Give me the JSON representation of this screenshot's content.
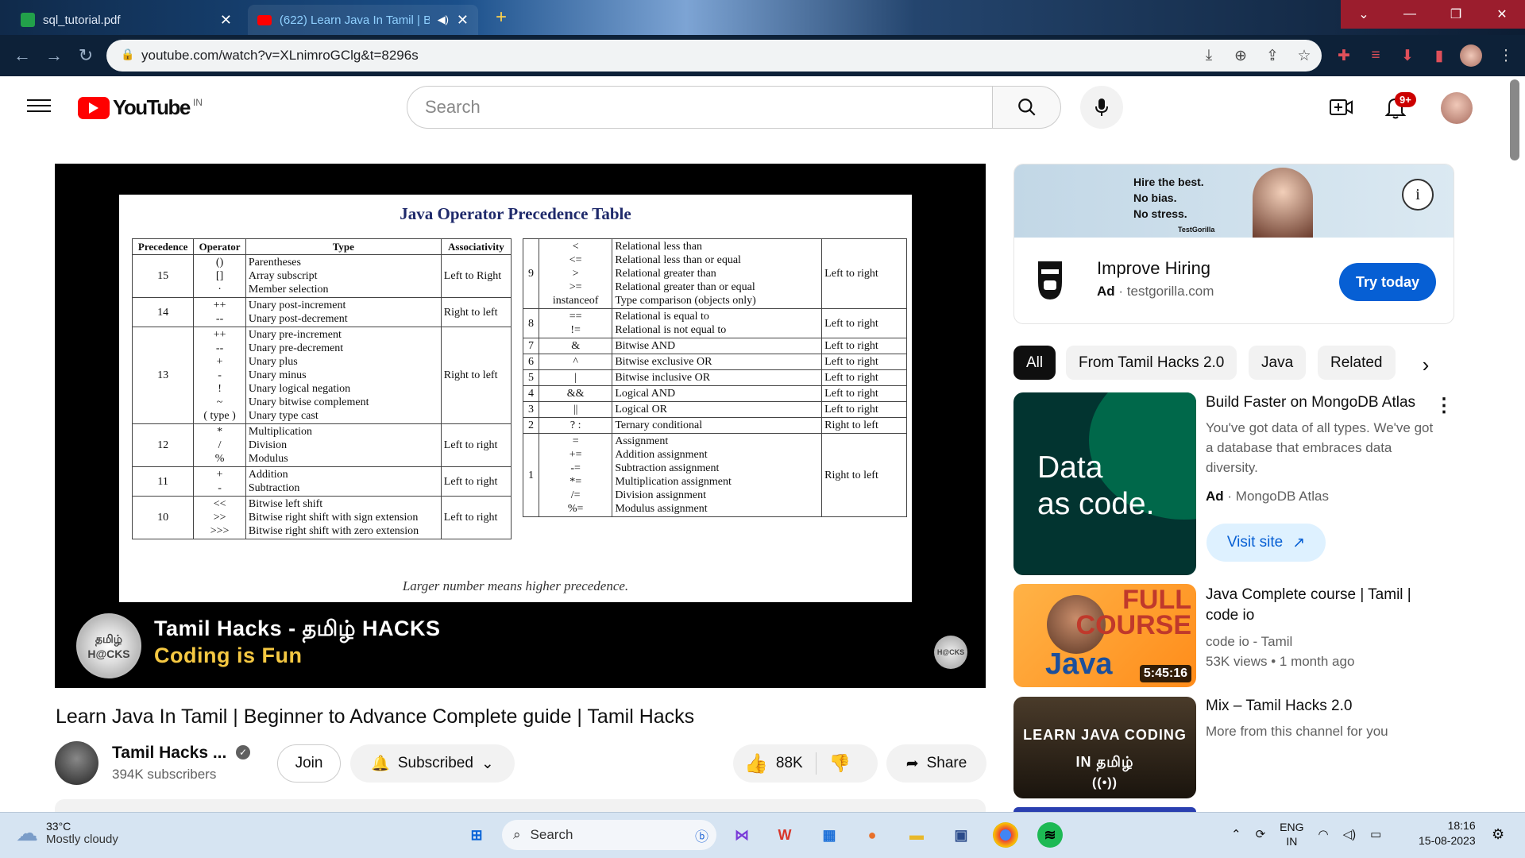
{
  "browser": {
    "tabs": [
      {
        "label": "sql_tutorial.pdf"
      },
      {
        "label": "(622) Learn Java In Tamil | Be"
      }
    ],
    "new_tab_glyph": "+",
    "url": "youtube.com/watch?v=XLnimroGClg&t=8296s"
  },
  "youtube": {
    "logo_text": "YouTube",
    "country": "IN",
    "search_placeholder": "Search",
    "notification_badge": "9+"
  },
  "video": {
    "slide_title": "Java Operator Precedence Table",
    "left_table": {
      "headers": [
        "Precedence",
        "Operator",
        "Type",
        "Associativity"
      ],
      "rows": [
        {
          "prec": "15",
          "ops": "()\n[]\n·",
          "types": "Parentheses\nArray subscript\nMember selection",
          "assoc": "Left to Right"
        },
        {
          "prec": "14",
          "ops": "++\n--",
          "types": "Unary post-increment\nUnary post-decrement",
          "assoc": "Right to left"
        },
        {
          "prec": "13",
          "ops": "++\n--\n+\n-\n!\n~\n( type )",
          "types": "Unary pre-increment\nUnary pre-decrement\nUnary plus\nUnary minus\nUnary logical negation\nUnary bitwise complement\nUnary type cast",
          "assoc": "Right to left"
        },
        {
          "prec": "12",
          "ops": "*\n/\n%",
          "types": "Multiplication\nDivision\nModulus",
          "assoc": "Left to right"
        },
        {
          "prec": "11",
          "ops": "+\n-",
          "types": "Addition\nSubtraction",
          "assoc": "Left to right"
        },
        {
          "prec": "10",
          "ops": "<<\n>>\n>>>",
          "types": "Bitwise left shift\nBitwise right shift with sign extension\nBitwise right shift with zero extension",
          "assoc": "Left to right"
        }
      ]
    },
    "right_table": {
      "rows": [
        {
          "prec": "9",
          "ops": "<\n<=\n>\n>=\ninstanceof",
          "types": "Relational less than\nRelational less than or equal\nRelational greater than\nRelational greater than or equal\nType comparison (objects only)",
          "assoc": "Left to right"
        },
        {
          "prec": "8",
          "ops": "==\n!=",
          "types": "Relational is equal to\nRelational is not equal to",
          "assoc": "Left to right"
        },
        {
          "prec": "7",
          "ops": "&",
          "types": "Bitwise AND",
          "assoc": "Left to right"
        },
        {
          "prec": "6",
          "ops": "^",
          "types": "Bitwise exclusive OR",
          "assoc": "Left to right"
        },
        {
          "prec": "5",
          "ops": "|",
          "types": "Bitwise inclusive OR",
          "assoc": "Left to right"
        },
        {
          "prec": "4",
          "ops": "&&",
          "types": "Logical AND",
          "assoc": "Left to right"
        },
        {
          "prec": "3",
          "ops": "||",
          "types": "Logical OR",
          "assoc": "Left to right"
        },
        {
          "prec": "2",
          "ops": "? :",
          "types": "Ternary conditional",
          "assoc": "Right to left"
        },
        {
          "prec": "1",
          "ops": "=\n+=\n-=\n*=\n/=\n%=",
          "types": "Assignment\nAddition assignment\nSubtraction assignment\nMultiplication assignment\nDivision assignment\nModulus assignment",
          "assoc": "Right to left"
        }
      ]
    },
    "slide_footer": "Larger number means higher precedence.",
    "overlay_line1": "Tamil Hacks - தமிழ் HACKS",
    "overlay_line2": "Coding is Fun",
    "channel_logo_text": "தமிழ் H@CKS",
    "title": "Learn Java In Tamil | Beginner to Advance Complete guide | Tamil Hacks",
    "channel_name": "Tamil Hacks ...",
    "subscribers": "394K subscribers",
    "join_label": "Join",
    "subscribed_label": "Subscribed",
    "likes": "88K",
    "share_label": "Share"
  },
  "sidebar": {
    "ad": {
      "banner_lines": [
        "Hire the best.",
        "No bias.",
        "No stress."
      ],
      "banner_brand": "TestGorilla",
      "headline": "Improve Hiring",
      "ad_label": "Ad",
      "domain": "testgorilla.com",
      "cta": "Try today"
    },
    "chips": [
      "All",
      "From Tamil Hacks 2.0",
      "Java",
      "Related"
    ],
    "items": [
      {
        "thumb_text": "Data\nas code.",
        "title": "Build Faster on MongoDB Atlas",
        "desc": "You've got data of all types. We've got a database that embraces data diversity.",
        "ad_label": "Ad",
        "advertiser": "MongoDB Atlas",
        "cta": "Visit site"
      },
      {
        "thumb_full": "FULL\nCOURSE",
        "thumb_java": "Java",
        "duration": "5:45:16",
        "title": "Java Complete course | Tamil | code io",
        "channel": "code io - Tamil",
        "views": "53K views",
        "age": "1 month ago"
      },
      {
        "thumb_line1": "LEARN  JAVA CODING",
        "thumb_line2": "IN தமிழ்",
        "title": "Mix – Tamil Hacks 2.0",
        "subtitle": "More from this channel for you"
      }
    ]
  },
  "taskbar": {
    "temperature": "33°C",
    "weather": "Mostly cloudy",
    "search_label": "Search",
    "lang_line1": "ENG",
    "lang_line2": "IN",
    "time": "18:16",
    "date": "15-08-2023"
  },
  "colors": {
    "youtube_red": "#ff0000",
    "subscribe_blue": "#065fd4",
    "mongodb_green": "#00684a"
  }
}
